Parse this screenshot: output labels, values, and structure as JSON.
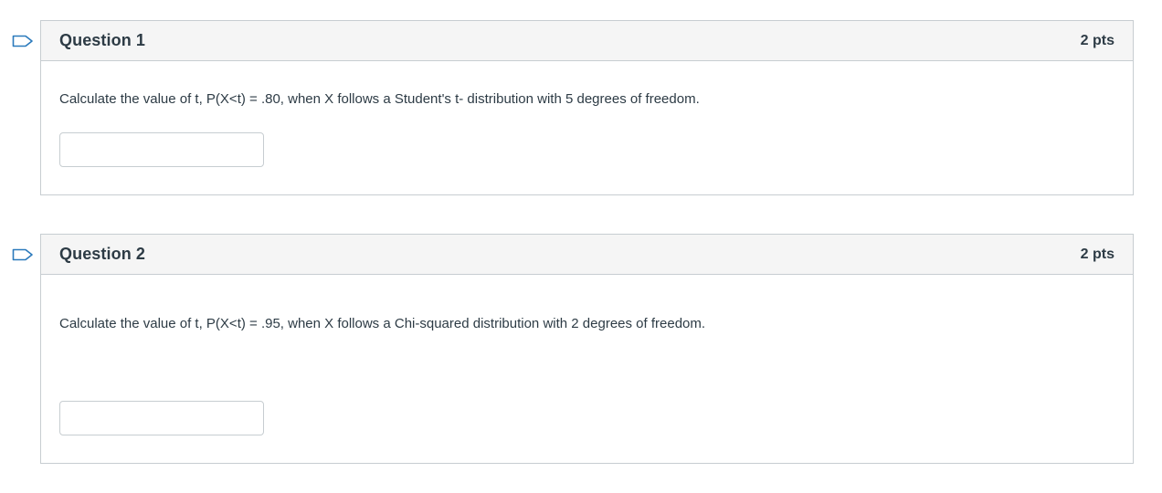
{
  "questions": [
    {
      "title": "Question 1",
      "points": "2 pts",
      "text": "Calculate the value of t,  P(X<t) = .80, when X follows a Student's t- distribution with 5 degrees of freedom.",
      "answer_value": ""
    },
    {
      "title": "Question 2",
      "points": "2 pts",
      "text": "Calculate the value of t,  P(X<t) = .95, when X follows a Chi-squared distribution with 2 degrees of freedom.",
      "answer_value": ""
    }
  ],
  "colors": {
    "flag": "#2b7abc",
    "border": "#c7cdd1",
    "header_bg": "#f5f5f5",
    "text": "#2d3b45"
  },
  "icons": {
    "flag": "flag-question-icon"
  }
}
